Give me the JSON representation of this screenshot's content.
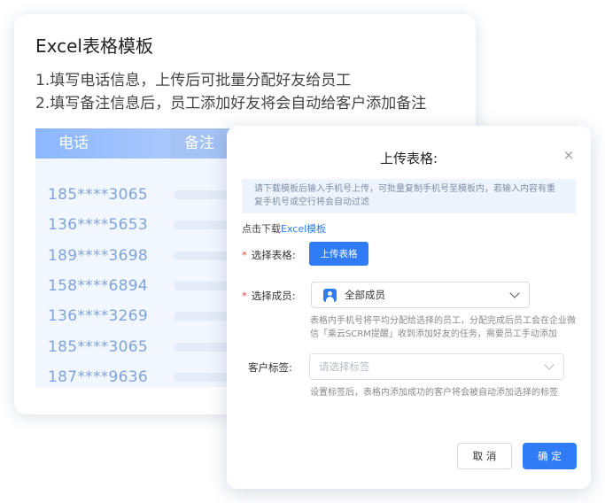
{
  "template_card": {
    "title": "Excel表格模板",
    "line1": "1.填写电话信息，上传后可批量分配好友给员工",
    "line2": "2.填写备注信息后，员工添加好友将会自动给客户添加备注",
    "table": {
      "headers": [
        "电话",
        "备注"
      ],
      "phones": [
        "185****3065",
        "136****5653",
        "189****3698",
        "158****6894",
        "136****3269",
        "185****3065",
        "187****9636"
      ]
    }
  },
  "dialog": {
    "title": "上传表格:",
    "close_glyph": "×",
    "tip": "请下载模板后输入手机号上传，可批量复制手机号至模板内，若输入内容有重复手机号或空行将会自动过滤",
    "download_prefix": "点击下载",
    "download_link": "Excel模板",
    "table_label": "选择表格:",
    "upload_button": "上传表格",
    "member_label": "选择成员:",
    "member_value": "全部成员",
    "member_help": "表格内手机号将平均分配给选择的员工，分配完成后员工会在企业微信「乘云SCRM提醒」收到添加好友的任务，需要员工手动添加",
    "tag_label": "客户标签:",
    "tag_placeholder": "请选择标签",
    "tag_help": "设置标签后，表格内添加成功的客户将会被自动添加选择的标签",
    "cancel_button": "取 消",
    "ok_button": "确 定",
    "required_mark": "*"
  },
  "colors": {
    "accent": "#2f7cf6",
    "required": "#f0443a"
  },
  "icons": {
    "member": "user-avatar-icon",
    "dropdown": "chevron-down-icon",
    "close": "close-icon"
  }
}
